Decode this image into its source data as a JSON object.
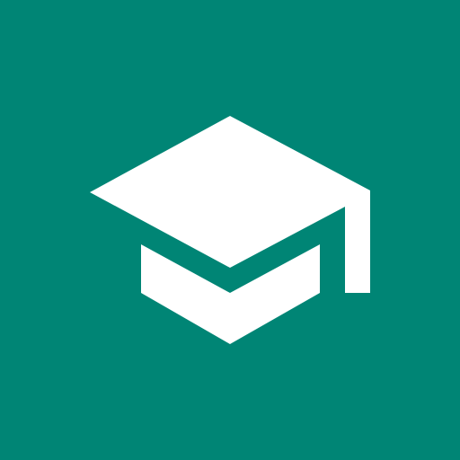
{
  "icon": {
    "name": "graduation-cap-icon",
    "background_color": "#008575",
    "foreground_color": "#FFFFFF"
  }
}
